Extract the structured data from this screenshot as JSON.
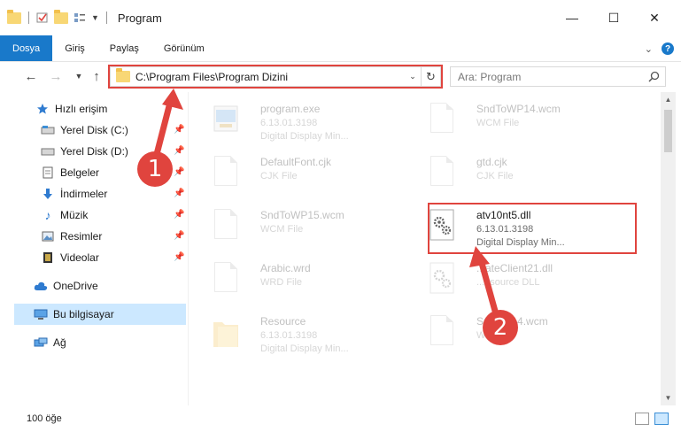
{
  "window": {
    "title": "Program",
    "minimize": "—",
    "maximize": "☐",
    "close": "✕"
  },
  "ribbon": {
    "tabs": [
      "Dosya",
      "Giriş",
      "Paylaş",
      "Görünüm"
    ],
    "active_tab": "Dosya",
    "help": "?"
  },
  "nav": {
    "address": "C:\\Program Files\\Program Dizini",
    "search_placeholder": "Ara: Program"
  },
  "navpane": {
    "items": [
      {
        "label": "Hızlı erişim",
        "icon": "star-icon"
      },
      {
        "label": "Yerel Disk (C:)",
        "icon": "drive-icon",
        "pinned": true
      },
      {
        "label": "Yerel Disk (D:)",
        "icon": "drive-icon",
        "pinned": true
      },
      {
        "label": "Belgeler",
        "icon": "documents-icon",
        "pinned": true
      },
      {
        "label": "İndirmeler",
        "icon": "download-icon",
        "pinned": true
      },
      {
        "label": "Müzik",
        "icon": "music-icon",
        "pinned": true
      },
      {
        "label": "Resimler",
        "icon": "pictures-icon",
        "pinned": true
      },
      {
        "label": "Videolar",
        "icon": "videos-icon",
        "pinned": true
      },
      {
        "label": "OneDrive",
        "icon": "cloud-icon"
      },
      {
        "label": "Bu bilgisayar",
        "icon": "computer-icon",
        "selected": true
      },
      {
        "label": "Ağ",
        "icon": "network-icon"
      }
    ]
  },
  "files": [
    {
      "name": "program.exe",
      "line2": "6.13.01.3198",
      "line3": "Digital Display Min...",
      "icon": "exe-icon"
    },
    {
      "name": "SndToWP14.wcm",
      "line2": "WCM File",
      "line3": "",
      "icon": "document-icon"
    },
    {
      "name": "DefaultFont.cjk",
      "line2": "CJK File",
      "line3": "",
      "icon": "document-icon"
    },
    {
      "name": "gtd.cjk",
      "line2": "CJK File",
      "line3": "",
      "icon": "document-icon"
    },
    {
      "name": "SndToWP15.wcm",
      "line2": "WCM File",
      "line3": "",
      "icon": "document-icon"
    },
    {
      "name": "atv10nt5.dll",
      "line2": "6.13.01.3198",
      "line3": "Digital Display Min...",
      "icon": "dll-gears-icon"
    },
    {
      "name": "Arabic.wrd",
      "line2": "WRD File",
      "line3": "",
      "icon": "document-icon"
    },
    {
      "name": "...ateClient21.dll",
      "line2": "...esource DLL",
      "line3": "",
      "icon": "dll-gears-icon"
    },
    {
      "name": "Resource",
      "line2": "6.13.01.3198",
      "line3": "Digital Display Min...",
      "icon": "folder-icon"
    },
    {
      "name": "Snd...P14.wcm",
      "line2": "W...",
      "line3": "",
      "icon": "document-icon"
    }
  ],
  "status": {
    "count": "100 öğe"
  },
  "annotations": {
    "badge1": "1",
    "badge2": "2"
  },
  "colors": {
    "accent": "#1979ca",
    "selection": "#cce8ff",
    "annotation": "#e0443e"
  }
}
